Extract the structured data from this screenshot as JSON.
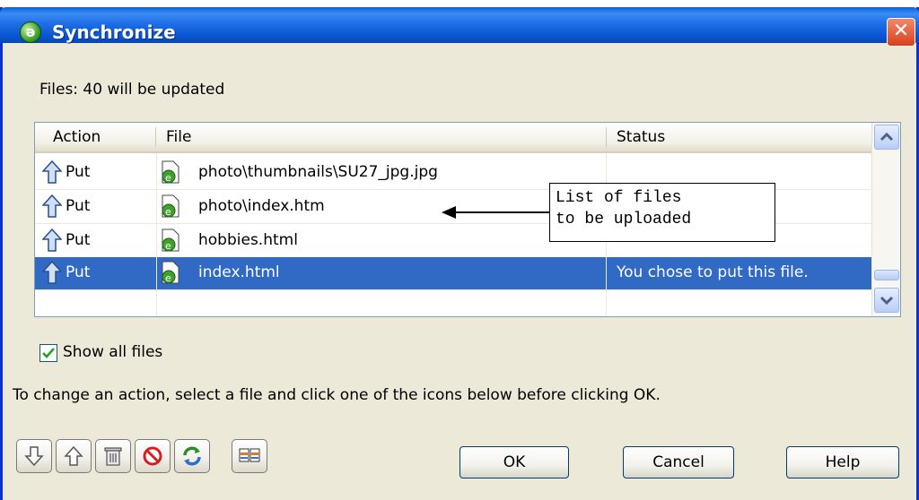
{
  "window": {
    "title": "Synchronize",
    "app_icon_glyph": "ə",
    "close_glyph": "✕"
  },
  "summary": "Files: 40 will be updated",
  "table": {
    "columns": [
      "Action",
      "File",
      "Status"
    ],
    "rows": [
      {
        "action": "Put",
        "file": "photo\\thumbnails\\SU27_jpg.jpg",
        "status": "",
        "selected": false
      },
      {
        "action": "Put",
        "file": "photo\\index.htm",
        "status": "",
        "selected": false
      },
      {
        "action": "Put",
        "file": "hobbies.html",
        "status": "",
        "selected": false
      },
      {
        "action": "Put",
        "file": "index.html",
        "status": "You chose to put this file.",
        "selected": true
      }
    ]
  },
  "callout": {
    "lines": [
      "List of files",
      "to be uploaded"
    ]
  },
  "show_all_files": {
    "label": "Show all files",
    "checked": true
  },
  "instructions": "To change an action, select a file and click one of the icons below before clicking OK.",
  "action_icons": [
    "get-arrow-icon",
    "put-arrow-icon",
    "delete-icon",
    "ignore-icon",
    "synchronize-icon",
    "compare-icon"
  ],
  "buttons": {
    "ok": "OK",
    "cancel": "Cancel",
    "help": "Help"
  },
  "colors": {
    "titlebar": "#0a56d0",
    "selection": "#316ac5",
    "dialog_bg": "#ece9d8"
  }
}
